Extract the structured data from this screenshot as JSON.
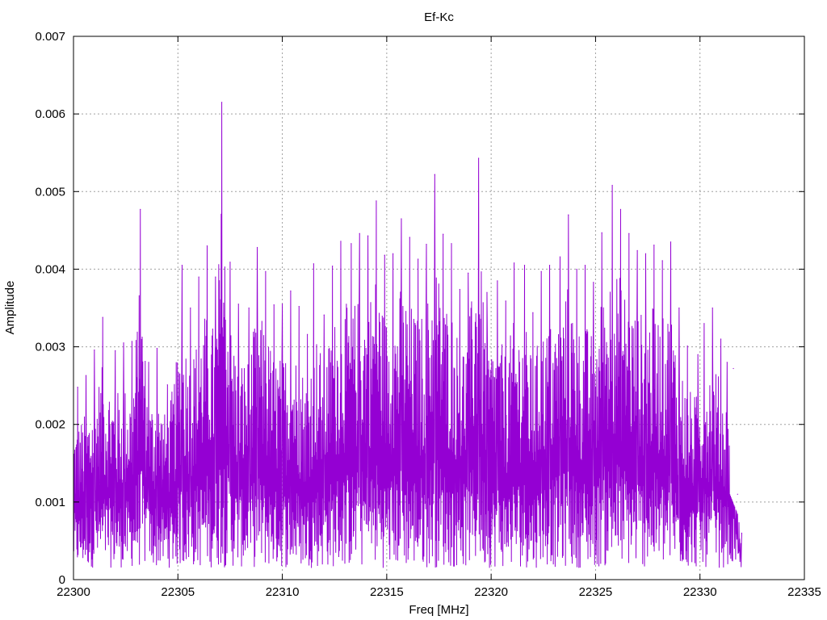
{
  "chart_data": {
    "type": "line",
    "title": "Ef-Kc",
    "xlabel": "Freq [MHz]",
    "ylabel": "Amplitude",
    "xlim": [
      22300,
      22335
    ],
    "ylim": [
      0,
      0.007
    ],
    "x_ticks": [
      "22300",
      "22305",
      "22310",
      "22315",
      "22320",
      "22325",
      "22330",
      "22335"
    ],
    "y_ticks": [
      "0",
      "0.001",
      "0.002",
      "0.003",
      "0.004",
      "0.005",
      "0.006",
      "0.007"
    ],
    "grid": true,
    "colors": {
      "series": "#9400d3",
      "grid": "#a0a0a0",
      "frame": "#000000"
    },
    "series": [
      {
        "x_start": 22300.0,
        "x_end": 22332.0,
        "peaks": [
          [
            22300.2,
            0.00248
          ],
          [
            22300.6,
            0.00263
          ],
          [
            22301.0,
            0.00296
          ],
          [
            22301.4,
            0.00338
          ],
          [
            22302.0,
            0.00295
          ],
          [
            22302.4,
            0.00305
          ],
          [
            22302.8,
            0.00307
          ],
          [
            22303.2,
            0.00477
          ],
          [
            22303.6,
            0.0028
          ],
          [
            22304.0,
            0.00298
          ],
          [
            22304.5,
            0.00251
          ],
          [
            22305.2,
            0.00405
          ],
          [
            22305.6,
            0.0035
          ],
          [
            22306.0,
            0.0039
          ],
          [
            22306.4,
            0.0043
          ],
          [
            22306.8,
            0.0039
          ],
          [
            22307.1,
            0.00615
          ],
          [
            22307.5,
            0.00409
          ],
          [
            22307.9,
            0.00355
          ],
          [
            22308.4,
            0.0035
          ],
          [
            22308.8,
            0.00428
          ],
          [
            22309.2,
            0.00397
          ],
          [
            22309.6,
            0.00354
          ],
          [
            22310.0,
            0.00355
          ],
          [
            22310.4,
            0.00372
          ],
          [
            22310.8,
            0.00352
          ],
          [
            22311.2,
            0.00316
          ],
          [
            22311.5,
            0.00407
          ],
          [
            22312.0,
            0.00341
          ],
          [
            22312.4,
            0.00404
          ],
          [
            22312.8,
            0.00436
          ],
          [
            22313.3,
            0.00433
          ],
          [
            22313.7,
            0.00446
          ],
          [
            22314.1,
            0.00443
          ],
          [
            22314.5,
            0.00488
          ],
          [
            22314.9,
            0.00418
          ],
          [
            22315.3,
            0.0042
          ],
          [
            22315.7,
            0.00465
          ],
          [
            22316.1,
            0.00441
          ],
          [
            22316.5,
            0.00413
          ],
          [
            22316.9,
            0.00432
          ],
          [
            22317.3,
            0.00522
          ],
          [
            22317.7,
            0.00445
          ],
          [
            22318.1,
            0.00433
          ],
          [
            22318.5,
            0.00374
          ],
          [
            22318.9,
            0.00395
          ],
          [
            22319.4,
            0.00543
          ],
          [
            22319.8,
            0.0037
          ],
          [
            22320.3,
            0.00385
          ],
          [
            22320.7,
            0.00359
          ],
          [
            22321.1,
            0.00408
          ],
          [
            22321.6,
            0.00405
          ],
          [
            22322.0,
            0.00344
          ],
          [
            22322.4,
            0.00397
          ],
          [
            22322.8,
            0.00405
          ],
          [
            22323.3,
            0.00416
          ],
          [
            22323.7,
            0.0047
          ],
          [
            22324.1,
            0.004
          ],
          [
            22324.5,
            0.00405
          ],
          [
            22324.9,
            0.00383
          ],
          [
            22325.3,
            0.00447
          ],
          [
            22325.8,
            0.00508
          ],
          [
            22326.2,
            0.00477
          ],
          [
            22326.6,
            0.00446
          ],
          [
            22327.0,
            0.00424
          ],
          [
            22327.4,
            0.0042
          ],
          [
            22327.8,
            0.00431
          ],
          [
            22328.2,
            0.00411
          ],
          [
            22328.6,
            0.00435
          ],
          [
            22329.0,
            0.0035
          ],
          [
            22329.4,
            0.00301
          ],
          [
            22329.9,
            0.0029
          ],
          [
            22330.2,
            0.0033
          ],
          [
            22330.6,
            0.0035
          ],
          [
            22331.0,
            0.0031
          ],
          [
            22331.3,
            0.0028
          ],
          [
            22331.6,
            0.00272
          ],
          [
            22331.8,
            0.0011
          ],
          [
            22332.0,
            0.0006
          ]
        ]
      }
    ]
  }
}
